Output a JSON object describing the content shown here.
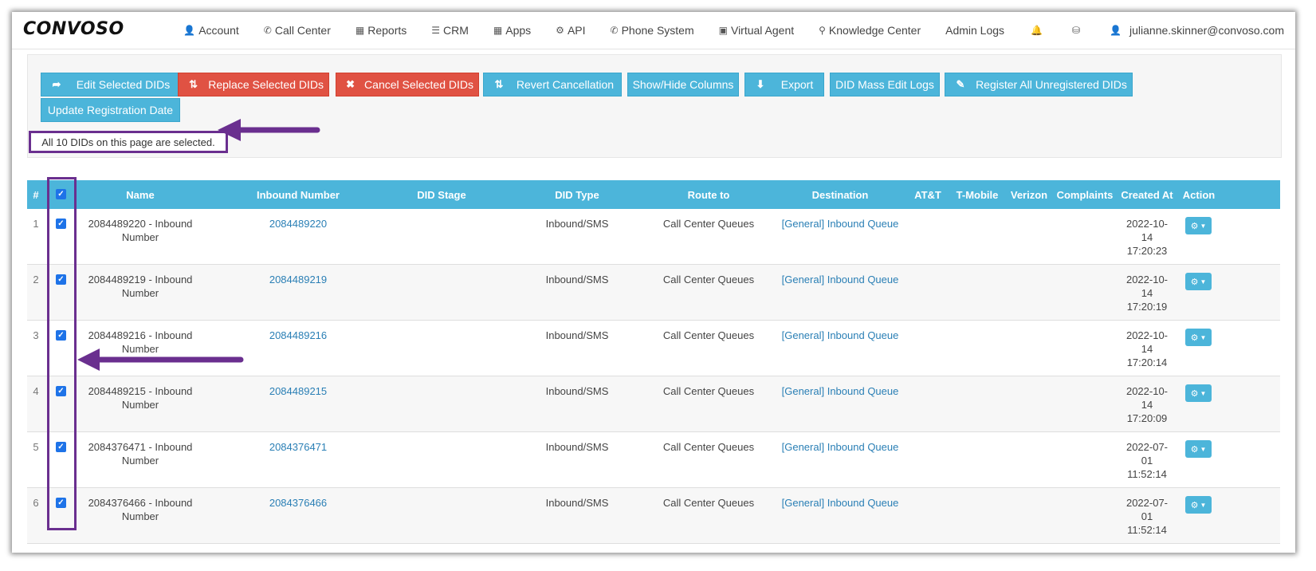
{
  "logo": "CONVOSO",
  "nav": [
    {
      "label": "Account",
      "icon": "user-icon"
    },
    {
      "label": "Call Center",
      "icon": "phone-icon"
    },
    {
      "label": "Reports",
      "icon": "bar-chart-icon"
    },
    {
      "label": "CRM",
      "icon": "list-icon"
    },
    {
      "label": "Apps",
      "icon": "grid-icon"
    },
    {
      "label": "API",
      "icon": "gear-icon"
    },
    {
      "label": "Phone System",
      "icon": "phone-icon"
    },
    {
      "label": "Virtual Agent",
      "icon": "monitor-icon"
    },
    {
      "label": "Knowledge Center",
      "icon": "lightbulb-icon"
    },
    {
      "label": "Admin Logs",
      "icon": ""
    }
  ],
  "user_email": "julianne.skinner@convoso.com",
  "actions": {
    "edit": "Edit Selected DIDs",
    "replace": "Replace Selected DIDs",
    "cancel": "Cancel Selected DIDs",
    "revert": "Revert Cancellation",
    "showhide": "Show/Hide Columns",
    "export": "Export",
    "masslogs": "DID Mass Edit Logs",
    "register": "Register All Unregistered DIDs",
    "update": "Update Registration Date"
  },
  "selection_note": "All 10 DIDs on this page are selected.",
  "table": {
    "headers": {
      "num": "#",
      "name": "Name",
      "inbound": "Inbound Number",
      "stage": "DID Stage",
      "type": "DID Type",
      "route": "Route to",
      "dest": "Destination",
      "att": "AT&T",
      "tmobile": "T-Mobile",
      "verizon": "Verizon",
      "complaints": "Complaints",
      "created": "Created At",
      "action": "Action"
    },
    "rows": [
      {
        "num": "1",
        "name1": "2084489220 - Inbound",
        "name2": "Number",
        "inbound": "2084489220",
        "type": "Inbound/SMS",
        "route": "Call Center Queues",
        "dest": "[General] Inbound Queue",
        "c1": "2022-10-",
        "c2": "14",
        "c3": "17:20:23"
      },
      {
        "num": "2",
        "name1": "2084489219 - Inbound",
        "name2": "Number",
        "inbound": "2084489219",
        "type": "Inbound/SMS",
        "route": "Call Center Queues",
        "dest": "[General] Inbound Queue",
        "c1": "2022-10-",
        "c2": "14",
        "c3": "17:20:19"
      },
      {
        "num": "3",
        "name1": "2084489216 - Inbound",
        "name2": "Number",
        "inbound": "2084489216",
        "type": "Inbound/SMS",
        "route": "Call Center Queues",
        "dest": "[General] Inbound Queue",
        "c1": "2022-10-",
        "c2": "14",
        "c3": "17:20:14"
      },
      {
        "num": "4",
        "name1": "2084489215 - Inbound",
        "name2": "Number",
        "inbound": "2084489215",
        "type": "Inbound/SMS",
        "route": "Call Center Queues",
        "dest": "[General] Inbound Queue",
        "c1": "2022-10-",
        "c2": "14",
        "c3": "17:20:09"
      },
      {
        "num": "5",
        "name1": "2084376471 - Inbound",
        "name2": "Number",
        "inbound": "2084376471",
        "type": "Inbound/SMS",
        "route": "Call Center Queues",
        "dest": "[General] Inbound Queue",
        "c1": "2022-07-",
        "c2": "01",
        "c3": "11:52:14"
      },
      {
        "num": "6",
        "name1": "2084376466 - Inbound",
        "name2": "Number",
        "inbound": "2084376466",
        "type": "Inbound/SMS",
        "route": "Call Center Queues",
        "dest": "[General] Inbound Queue",
        "c1": "2022-07-",
        "c2": "01",
        "c3": "11:52:14"
      }
    ]
  },
  "colors": {
    "accent": "#4cb5da",
    "danger": "#e05243",
    "annotation": "#6a2f8f",
    "checkbox": "#1e73e8"
  }
}
